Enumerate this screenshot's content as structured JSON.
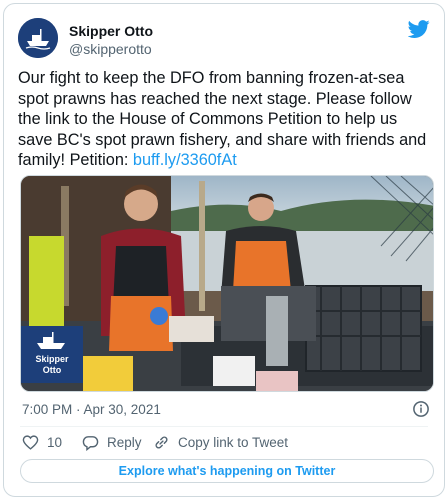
{
  "tweet": {
    "author_name": "Skipper Otto",
    "author_handle": "@skipperotto",
    "body_text": "Our fight to keep the DFO from banning frozen-at-sea spot prawns has reached the next stage. Please follow the link to the House of Commons Petition to help us save BC's spot prawn fishery, and share with friends and family! Petition: ",
    "link_text": "buff.ly/3360fAt",
    "timestamp": "7:00 PM · Apr 30, 2021",
    "likes_count": "10",
    "reply_label": "Reply",
    "copy_link_label": "Copy link to Tweet"
  },
  "media": {
    "logo_text_line1": "Skipper",
    "logo_text_line2": "Otto"
  },
  "footer": {
    "explore_label": "Explore what's happening on Twitter"
  },
  "colors": {
    "brand_blue": "#1d9bf0",
    "avatar_navy": "#1d3f7a",
    "muted_text": "#536471"
  },
  "icons": [
    "twitter-bird-icon",
    "info-icon",
    "heart-icon",
    "reply-icon",
    "link-icon",
    "boat-icon"
  ]
}
